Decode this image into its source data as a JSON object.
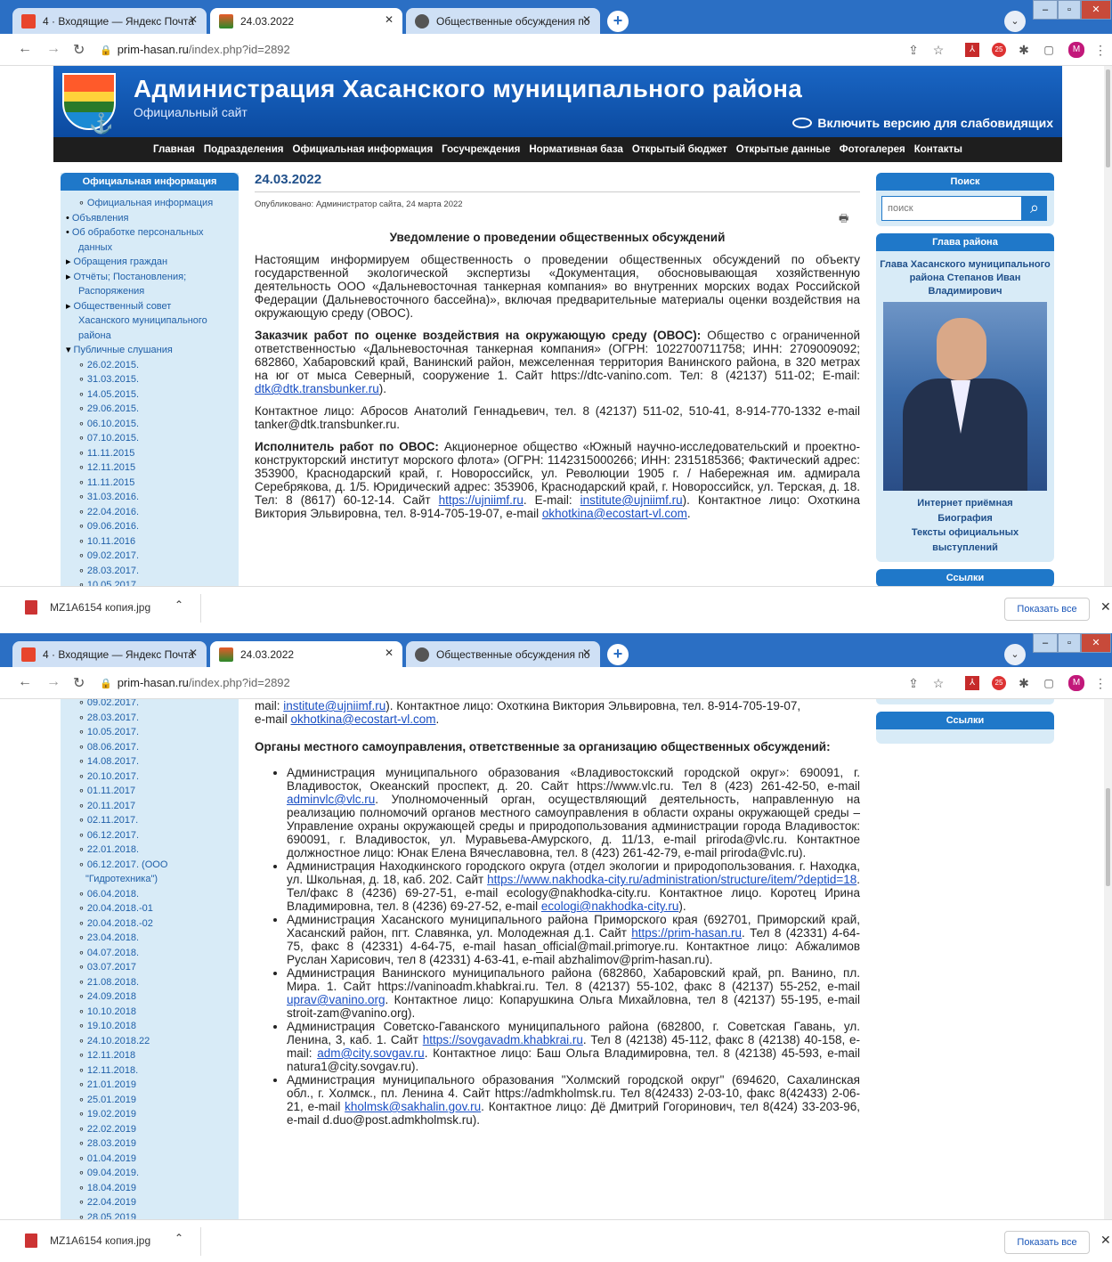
{
  "browser": {
    "tabs": [
      {
        "label": "4 · Входящие — Яндекс Почта"
      },
      {
        "label": "24.03.2022"
      },
      {
        "label": "Общественные обсуждения по"
      }
    ],
    "url_host": "prim-hasan.ru",
    "url_path": "/index.php?id=2892",
    "profile_initial": "M",
    "ext_badge": "25"
  },
  "download": {
    "filename": "MZ1A6154 копия.jpg",
    "show_all": "Показать все"
  },
  "site": {
    "title": "Администрация Хасанского муниципального района",
    "subtitle": "Официальный сайт",
    "accessibility": "Включить версию для слабовидящих",
    "nav": [
      "Главная",
      "Подразделения",
      "Официальная информация",
      "Госучреждения",
      "Нормативная база",
      "Открытый бюджет",
      "Открытые данные",
      "Фотогалерея",
      "Контакты"
    ]
  },
  "left": {
    "heading": "Официальная информация",
    "menu": [
      {
        "t": "sub",
        "text": "Официальная информация"
      },
      {
        "t": "b",
        "text": "Объявления"
      },
      {
        "t": "b",
        "text": "Об обработке персональных"
      },
      {
        "t": "i",
        "text": "данных"
      },
      {
        "t": "t",
        "text": "Обращения граждан"
      },
      {
        "t": "t",
        "text": "Отчёты; Постановления;"
      },
      {
        "t": "i",
        "text": "Распоряжения"
      },
      {
        "t": "t",
        "text": "Общественный совет"
      },
      {
        "t": "i",
        "text": "Хасанского муниципального"
      },
      {
        "t": "i",
        "text": "района"
      },
      {
        "t": "d",
        "text": "Публичные слушания"
      }
    ],
    "dates1": [
      "26.02.2015.",
      "31.03.2015.",
      "14.05.2015.",
      "29.06.2015.",
      "06.10.2015.",
      "07.10.2015.",
      "11.11.2015",
      "12.11.2015",
      "11.11.2015",
      "31.03.2016.",
      "22.04.2016.",
      "09.06.2016.",
      "10.11.2016",
      "09.02.2017.",
      "28.03.2017.",
      "10.05.2017"
    ],
    "dates2": [
      "09.02.2017.",
      "28.03.2017.",
      "10.05.2017.",
      "08.06.2017.",
      "14.08.2017.",
      "20.10.2017.",
      "01.11.2017",
      "20.11.2017",
      "02.11.2017.",
      "06.12.2017.",
      "22.01.2018.",
      "06.12.2017. (ООО",
      "\"Гидротехника\")",
      "06.04.2018.",
      "20.04.2018.-01",
      "20.04.2018.-02",
      "23.04.2018.",
      "04.07.2018.",
      "03.07.2017",
      "21.08.2018.",
      "24.09.2018",
      "10.10.2018",
      "19.10.2018",
      "24.10.2018.22",
      "12.11.2018",
      "12.11.2018.",
      "21.01.2019",
      "25.01.2019",
      "19.02.2019",
      "22.02.2019",
      "28.03.2019",
      "01.04.2019",
      "09.04.2019.",
      "18.04.2019",
      "22.04.2019",
      "28.05.2019"
    ]
  },
  "article": {
    "title": "24.03.2022",
    "meta": "Опубликовано: Администратор сайта, 24 марта 2022",
    "notice_title": "Уведомление о проведении общественных обсуждений",
    "p1": "Настоящим информируем общественность о проведении общественных обсуждений по объекту государственной экологической экспертизы «Документация, обосновывающая хозяйственную деятельность ООО «Дальневосточная танкерная компания» во внутренних морских водах Российской Федерации (Дальневосточного бассейна)», включая предварительные материалы оценки воздействия на окружающую среду (ОВОС).",
    "p2_bold": "Заказчик работ по оценке воздействия на окружающую среду (ОВОС):",
    "p2": " Общество с ограниченной ответственностью «Дальневосточная танкерная компания» (ОГРН: 1022700711758; ИНН: 2709009092; 682860, Хабаровский край, Ванинский район, межселенная территория Ванинского района, в 320 метрах на юг от мыса Северный, сооружение 1. Сайт https://dtc-vanino.com. Тел: 8 (42137) 511-02; E-mail: ",
    "p2_link": "dtk@dtk.transbunker.ru",
    "p2_end": ").",
    "p3": "Контактное лицо: Абросов Анатолий Геннадьевич, тел. 8 (42137) 511-02, 510-41, 8-914-770-1332 e-mail tanker@dtk.transbunker.ru.",
    "p4_bold": "Исполнитель работ по ОВОС:",
    "p4": " Акционерное общество «Южный научно-исследовательский и проектно-конструкторский институт морского флота» (ОГРН: 1142315000266; ИНН: 2315185366; Фактический адрес: 353900, Краснодарский край, г. Новороссийск, ул. Революции 1905 г. / Набережная им. адмирала Серебрякова, д. 1/5. Юридический адрес: 353906, Краснодарский край, г. Новороссийск, ул. Терская, д. 18. Тел: 8 (8617) 60-12-14. Сайт ",
    "p4_link1": "https://ujniimf.ru",
    "p4_mid": ". E-mail: ",
    "p4_link2": "institute@ujniimf.ru",
    "p4_mid2": "). Контактное лицо: Охоткина Виктория Эльвировна, тел. 8-914-705-19-07, e-mail ",
    "p4_link3": "okhotkina@ecostart-vl.com",
    "p4_end": ".",
    "w2_top1": "mail: ",
    "w2_top_link": "institute@ujniimf.ru",
    "w2_top2": "). Контактное лицо: Охоткина Виктория Эльвировна, тел. 8-914-705-19-07,",
    "w2_top3": "e-mail ",
    "w2_top_link2": "okhotkina@ecostart-vl.com",
    "w2_top4": ".",
    "organs_title": "Органы местного самоуправления, ответственные за организацию общественных обсуждений:",
    "li1a": "Администрация муниципального образования «Владивостокский городской округ»: 690091, г. Владивосток, Океанский проспект, д. 20. Сайт https://www.vlc.ru. Тел 8 (423) 261-42-50, e-mail ",
    "li1_link": "adminvlc@vlc.ru",
    "li1b": ". Уполномоченный орган, осуществляющий деятельность, направленную на реализацию полномочий органов местного самоуправления в области охраны окружающей среды – Управление охраны окружающей среды и природопользования администрации города Владивосток: 690091, г. Владивосток, ул. Муравьева-Амурского, д. 11/13, e-mail priroda@vlc.ru. Контактное должностное лицо: Юнак Елена Вячеславовна, тел. 8 (423) 261-42-79, e-mail priroda@vlc.ru).",
    "li2a": "Администрация Находкинского городского округа (отдел экологии и природопользования. г. Находка, ул. Школьная, д. 18, каб. 202. Сайт ",
    "li2_link": "https://www.nakhodka-city.ru/administration/structure/item/?deptid=18",
    "li2b": ". Тел/факс 8 (4236) 69-27-51, e-mail ecology@nakhodka-city.ru. Контактное лицо. Коротец Ирина Владимировна, тел. 8 (4236) 69-27-52, e-mail ",
    "li2_link2": "ecologi@nakhodka-city.ru",
    "li2c": ").",
    "li3a": "Администрация Хасанского муниципального района Приморского края (692701, Приморский край, Хасанский район, пгт. Славянка, ул. Молодежная д.1. Сайт ",
    "li3_link": "https://prim-hasan.ru",
    "li3b": ". Тел 8 (42331) 4-64-75, факс 8 (42331) 4-64-75, e-mail hasan_official@mail.primorye.ru. Контактное лицо: Абжалимов Руслан Харисович, тел 8 (42331) 4-63-41, e-mail abzhalimov@prim-hasan.ru).",
    "li4a": "Администрация Ванинского муниципального района (682860, Хабаровский край, рп. Ванино, пл. Мира. 1. Сайт https://vaninoadm.khabkrai.ru. Тел. 8 (42137) 55-102, факс 8 (42137) 55-252, e-mail ",
    "li4_link": "uprav@vanino.org",
    "li4b": ". Контактное лицо: Копарушкина Ольга Михайловна, тел 8 (42137) 55-195, e-mail stroit-zam@vanino.org).",
    "li5a": "Администрация Советско-Гаванского муниципального района (682800, г. Советская Гавань, ул. Ленина, 3, каб. 1. Сайт ",
    "li5_link": "https://sovgavadm.khabkrai.ru",
    "li5b": ". Тел 8 (42138) 45-112, факс 8 (42138) 40-158, e-mail: ",
    "li5_link2": "adm@city.sovgav.ru",
    "li5c": ". Контактное лицо: Баш Ольга Владимировна, тел. 8 (42138) 45-593, e-mail natura1@city.sovgav.ru).",
    "li6a": "Администрация муниципального образования \"Холмский городской округ\" (694620, Сахалинская обл., г. Холмск., пл. Ленина 4. Сайт https://admkholmsk.ru. Тел 8(42433) 2-03-10, факс 8(42433) 2-06-21, e-mail ",
    "li6_link": "kholmsk@sakhalin.gov.ru",
    "li6b": ". Контактное лицо: Дё Дмитрий Гогоринович, тел 8(424) 33-203-96, e-mail d.duo@post.admkholmsk.ru)."
  },
  "right": {
    "search_heading": "Поиск",
    "search_placeholder": "поиск",
    "glava_heading": "Глава района",
    "glava_name": "Глава Хасанского муниципального района Степанов Иван Владимирович",
    "links": [
      "Интернет приёмная",
      "Биография",
      "Тексты официальных выступлений"
    ],
    "links_heading": "Ссылки"
  }
}
